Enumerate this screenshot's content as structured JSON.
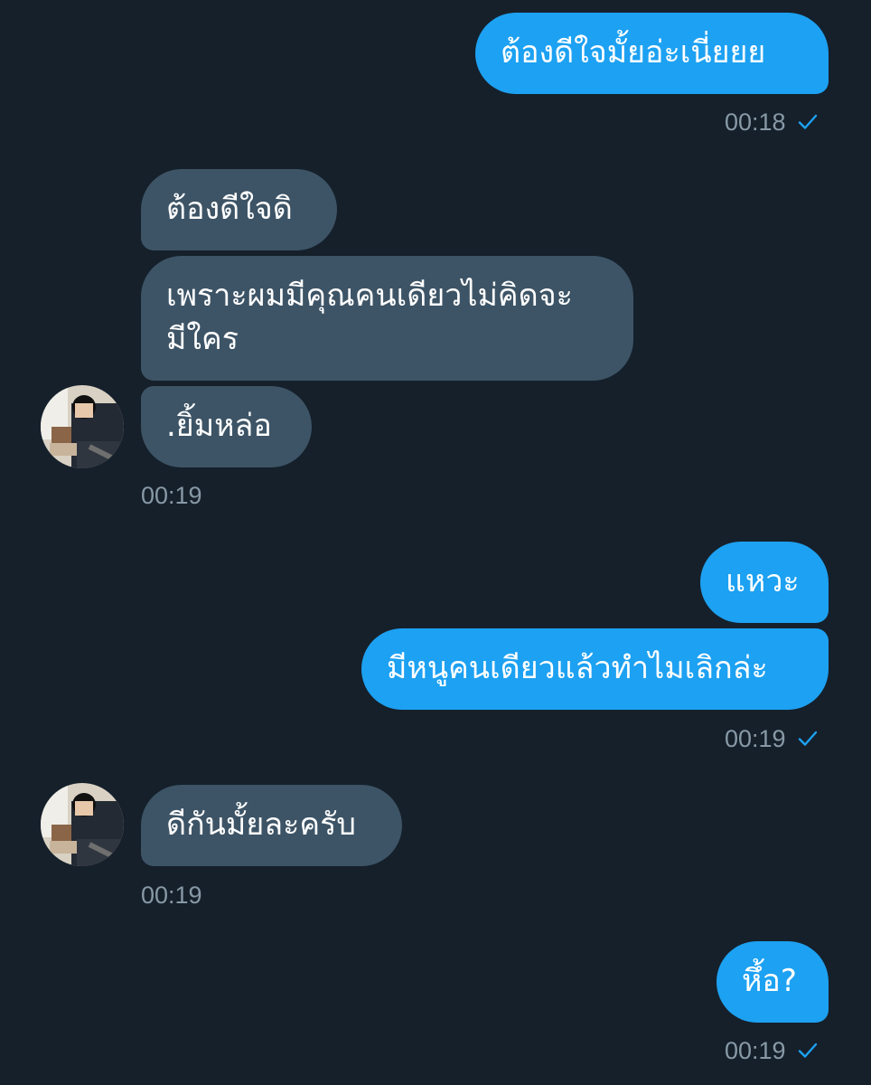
{
  "theme": {
    "background": "#15202b",
    "sent_bubble": "#1da1f2",
    "received_bubble": "#3d5466",
    "meta_text": "#8899a6",
    "check_color": "#1da1f2"
  },
  "messages": [
    {
      "direction": "sent",
      "text": "ต้องดีใจมั้ยอ่ะเนี่ยยย"
    },
    {
      "direction": "sent",
      "time": "00:18",
      "status_icon": "check-icon"
    },
    {
      "direction": "received",
      "text": "ต้องดีใจดิ"
    },
    {
      "direction": "received",
      "text": "เพราะผมมีคุณคนเดียวไม่คิดจะมีใคร"
    },
    {
      "direction": "received",
      "text": ".ยิ้มหล่อ"
    },
    {
      "direction": "received",
      "time": "00:19"
    },
    {
      "direction": "sent",
      "text": "แหวะ"
    },
    {
      "direction": "sent",
      "text": "มีหนูคนเดียวแล้วทำไมเลิกล่ะ"
    },
    {
      "direction": "sent",
      "time": "00:19",
      "status_icon": "check-icon"
    },
    {
      "direction": "received",
      "text": "ดีกันมั้ยละครับ"
    },
    {
      "direction": "received",
      "time": "00:19"
    },
    {
      "direction": "sent",
      "text": "หึ้อ?"
    },
    {
      "direction": "sent",
      "time": "00:19",
      "status_icon": "check-icon"
    }
  ],
  "message_texts": {
    "m1": "ต้องดีใจมั้ยอ่ะเนี่ยยย",
    "m2": "ต้องดีใจดิ",
    "m3_line1": "เพราะผมมีคุณคนเดียวไม่คิดจะ",
    "m3_line2": "มีใคร",
    "m4": ".ยิ้มหล่อ",
    "m5": "แหวะ",
    "m6": "มีหนูคนเดียวแล้วทำไมเลิกล่ะ",
    "m7": "ดีกันมั้ยละครับ",
    "m8": "หึ้อ?"
  },
  "timestamps": {
    "t1": "00:18",
    "t2": "00:19",
    "t3": "00:19",
    "t4": "00:19",
    "t5": "00:19"
  }
}
